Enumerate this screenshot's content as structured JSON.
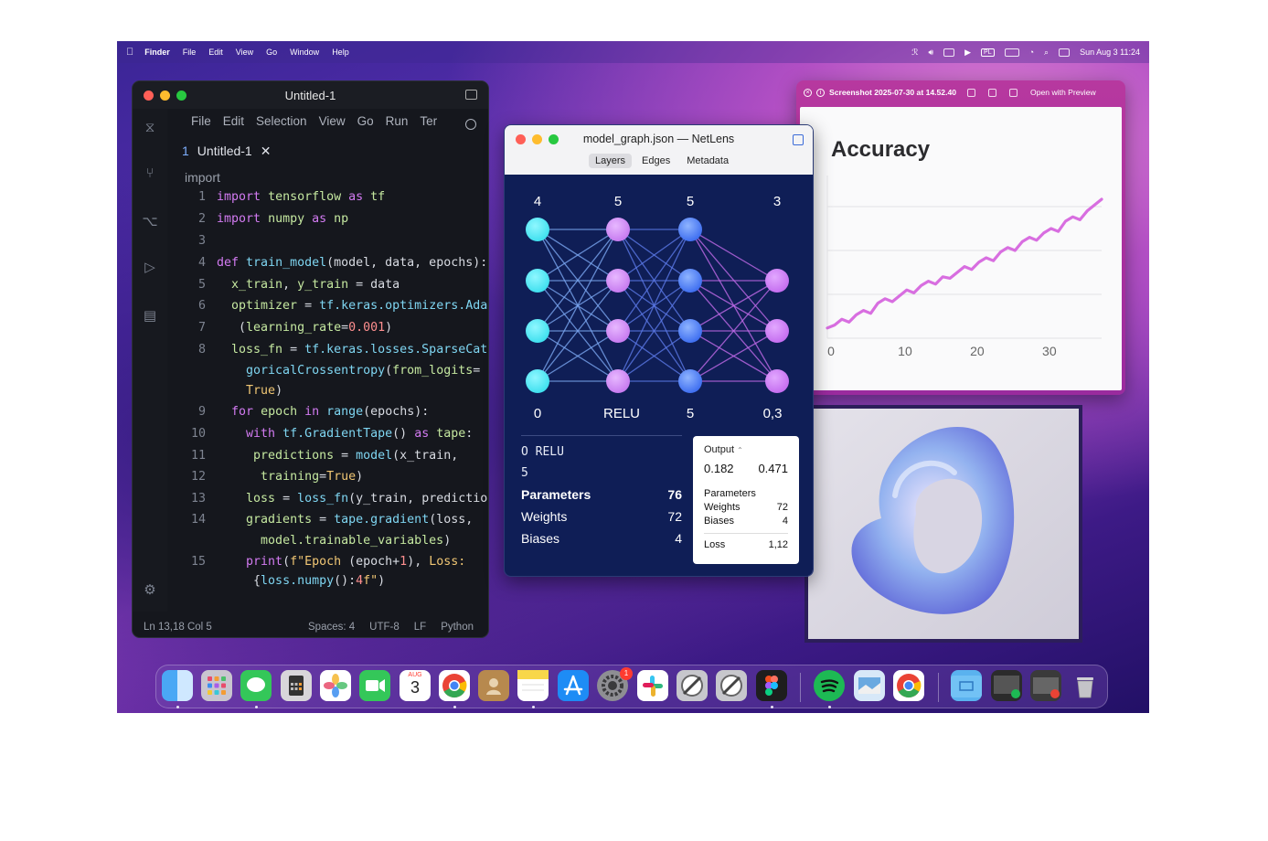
{
  "menubar": {
    "app": "Finder",
    "items": [
      "File",
      "Edit",
      "View",
      "Go",
      "Window",
      "Help"
    ],
    "clock": "Sun Aug 3  11:24",
    "keyboard": "PL"
  },
  "vscode": {
    "window_title": "Untitled-1",
    "menu": [
      "File",
      "Edit",
      "Selection",
      "View",
      "Go",
      "Run",
      "Ter"
    ],
    "tab": {
      "index": "1",
      "label": "Untitled-1",
      "close": "✕"
    },
    "breadcrumb": "import",
    "status": {
      "position": "Ln 13,18 Col 5",
      "spaces": "Spaces: 4",
      "encoding": "UTF-8",
      "eol": "LF",
      "language": "Python"
    }
  },
  "code_lines": [
    "1",
    "2",
    "3",
    "4",
    "5",
    "6",
    "7",
    "8",
    "9",
    "10",
    "11",
    "12",
    "13",
    "14",
    "15"
  ],
  "netlens": {
    "window_title": "model_graph.json — NetLens",
    "tabs": [
      "Layers",
      "Edges",
      "Metadata"
    ],
    "layer_counts": [
      "4",
      "5",
      "5",
      "3"
    ],
    "layer_labels": [
      "0",
      "RELU",
      "5",
      "0,3"
    ],
    "info": {
      "line1": "O RELU",
      "line2": "5",
      "parameters_label": "Parameters",
      "parameters_value": "76",
      "weights_label": "Weights",
      "weights_value": "72",
      "biases_label": "Biases",
      "biases_value": "4"
    },
    "card": {
      "output_label": "Output",
      "output_a": "0.182",
      "output_b": "0.471",
      "params_label": "Parameters",
      "weights_label": "Weights",
      "weights_value": "72",
      "biases_label": "Biases",
      "biases_value": "4",
      "loss_label": "Loss",
      "loss_value": "1,12"
    },
    "colors": {
      "input": "#3fe0ef",
      "hidden1": "#c77bf0",
      "hidden2": "#3f6ff0",
      "output": "#c56ef0"
    }
  },
  "preview": {
    "title": "Screenshot 2025-07-30 at 14.52.40",
    "open_label": "Open with Preview"
  },
  "chart_data": {
    "type": "line",
    "title": "Accuracy",
    "xlabel": "",
    "ylabel": "",
    "x_ticks": [
      "0",
      "10",
      "20",
      "30"
    ],
    "xlim": [
      0,
      38
    ],
    "ylim": [
      0,
      1
    ],
    "color": "#d86ee0",
    "grid": true,
    "x": [
      0,
      1,
      2,
      3,
      4,
      5,
      6,
      7,
      8,
      9,
      10,
      11,
      12,
      13,
      14,
      15,
      16,
      17,
      18,
      19,
      20,
      21,
      22,
      23,
      24,
      25,
      26,
      27,
      28,
      29,
      30,
      31,
      32,
      33,
      34,
      35,
      36,
      37,
      38
    ],
    "values": [
      0.02,
      0.04,
      0.08,
      0.06,
      0.11,
      0.14,
      0.12,
      0.19,
      0.22,
      0.2,
      0.24,
      0.28,
      0.26,
      0.31,
      0.34,
      0.32,
      0.37,
      0.36,
      0.4,
      0.44,
      0.42,
      0.47,
      0.5,
      0.48,
      0.54,
      0.57,
      0.55,
      0.61,
      0.64,
      0.62,
      0.67,
      0.7,
      0.68,
      0.75,
      0.78,
      0.76,
      0.82,
      0.86,
      0.9
    ]
  },
  "dock": {
    "calendar_month": "AUG",
    "calendar_day": "3",
    "settings_badge": "1",
    "apps": [
      "finder",
      "launchpad",
      "messages",
      "calculator",
      "photos",
      "facetime",
      "calendar",
      "chrome",
      "contacts",
      "notes",
      "app-store",
      "system-settings",
      "slack",
      "utility",
      "utility",
      "figma",
      "spotify",
      "preview",
      "chrome",
      "folder",
      "screenshot-stack",
      "screenshot-stack",
      "trash"
    ]
  }
}
